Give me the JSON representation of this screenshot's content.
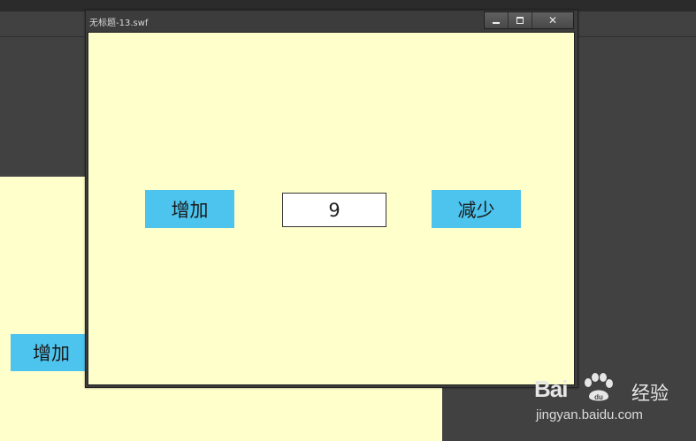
{
  "window": {
    "title": "无标题-13.swf",
    "controls": {
      "minimize": "minimize",
      "maximize": "maximize",
      "close": "✕"
    }
  },
  "stage": {
    "increase_label": "增加",
    "value": "9",
    "decrease_label": "减少"
  },
  "background_stage": {
    "increase_label": "增加"
  },
  "watermark": {
    "logo_text": "Bai",
    "logo_suffix": "经验",
    "url": "jingyan.baidu.com"
  },
  "colors": {
    "stage_bg": "#ffffcc",
    "button_bg": "#4dc4ee",
    "app_bg": "#414141"
  }
}
